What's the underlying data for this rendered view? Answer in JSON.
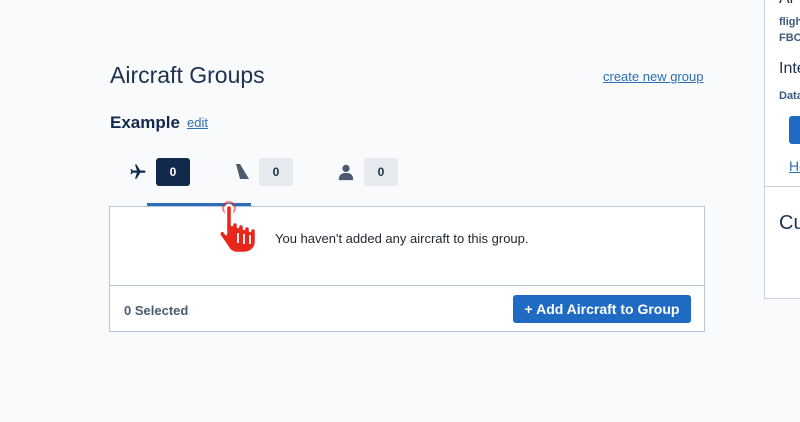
{
  "page": {
    "title": "Aircraft Groups",
    "create_link": "create new group"
  },
  "group": {
    "name": "Example",
    "edit_label": "edit"
  },
  "tabs": [
    {
      "icon": "airplane-icon",
      "count": "0",
      "active": true
    },
    {
      "icon": "tail-icon",
      "count": "0",
      "active": false
    },
    {
      "icon": "person-icon",
      "count": "0",
      "active": false
    }
  ],
  "panel": {
    "empty_message": "You haven't added any aircraft to this group.",
    "selected_label": "0 Selected",
    "add_button": "+ Add Aircraft to Group"
  },
  "side_panel": {
    "heading": "Ai",
    "flight_label": "fligh",
    "fbo_label": "FBO",
    "integration_heading": "Inte",
    "data_label": "Data",
    "link_label": "Ho",
    "bottom_heading": "Cu"
  },
  "colors": {
    "primary": "#1f6bc4",
    "navy": "#13294b",
    "link": "#2f6db5",
    "border": "#b8c7d6"
  }
}
